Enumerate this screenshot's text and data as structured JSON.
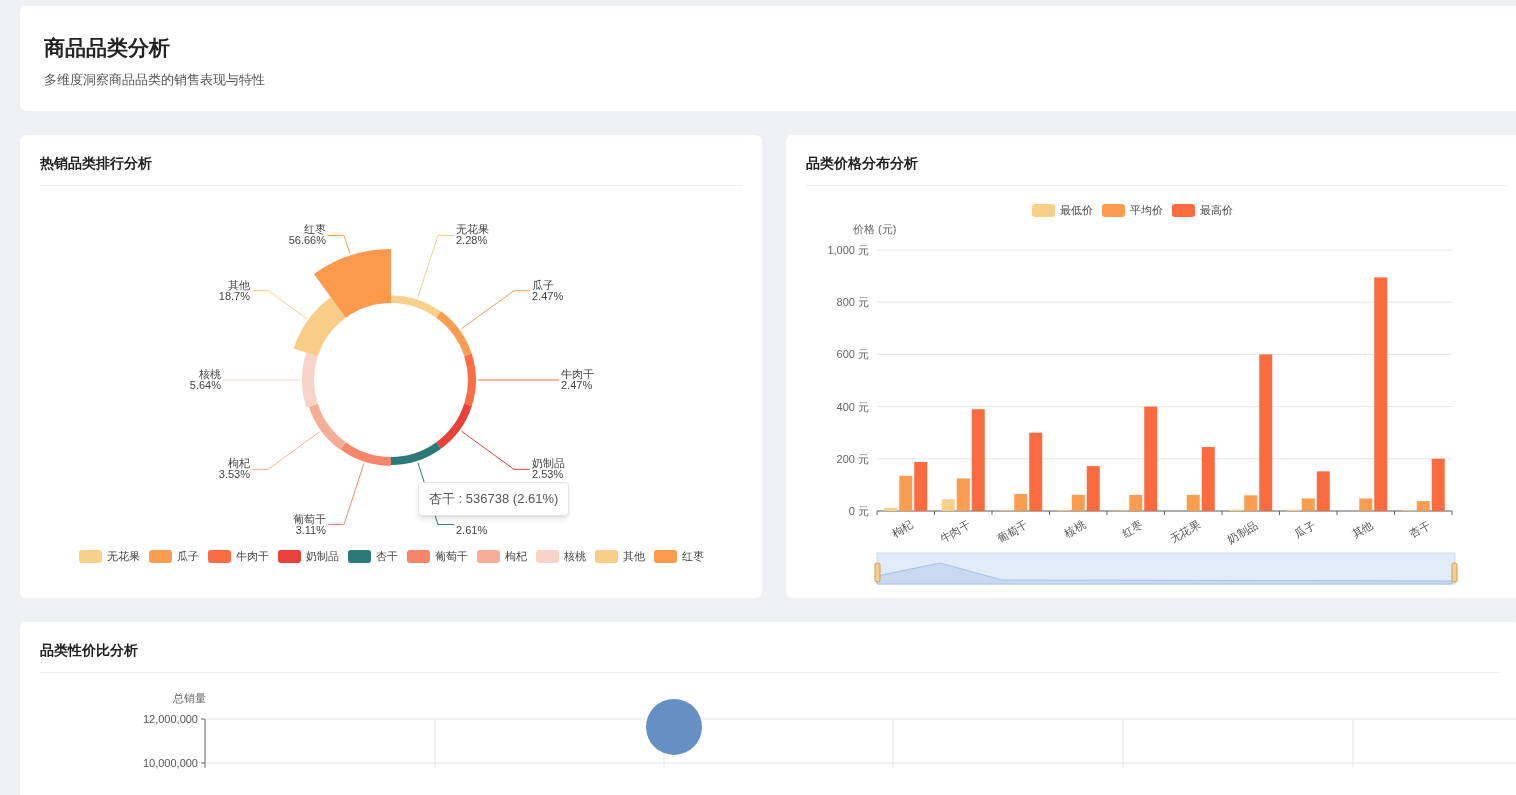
{
  "header": {
    "title": "商品品类分析",
    "subtitle": "多维度洞察商品品类的销售表现与特性"
  },
  "category_ranking": {
    "title": "热销品类排行分析",
    "slices": [
      {
        "kind": "labeled",
        "name": "无花果",
        "percent": "2.28%",
        "color": "#f9d08a"
      },
      {
        "kind": "labeled",
        "name": "瓜子",
        "percent": "2.47%",
        "color": "#fb9d50"
      },
      {
        "kind": "labeled",
        "name": "牛肉干",
        "percent": "2.47%",
        "color": "#fa6c41"
      },
      {
        "kind": "labeled",
        "name": "奶制品",
        "percent": "2.53%",
        "color": "#e8403a"
      },
      {
        "kind": "covered",
        "percent": "2.61%",
        "color": "#2c7a78"
      },
      {
        "kind": "labeled",
        "name": "葡萄干",
        "percent": "3.11%",
        "color": "#f4876a"
      },
      {
        "kind": "labeled",
        "name": "枸杞",
        "percent": "3.53%",
        "color": "#f5ad98"
      },
      {
        "kind": "labeled",
        "name": "核桃",
        "percent": "5.64%",
        "color": "#fad3c8"
      },
      {
        "kind": "labeled",
        "name": "其他",
        "percent": "18.7%",
        "color": "#f8cd85"
      },
      {
        "kind": "labeled",
        "name": "红枣",
        "percent": "56.66%",
        "color": "#fb9a4d"
      }
    ],
    "tooltip": "杏干 : 536738 (2.61%)",
    "legend": [
      {
        "label": "无花果",
        "color": "#f9d08a"
      },
      {
        "label": "瓜子",
        "color": "#fb9d50"
      },
      {
        "label": "牛肉干",
        "color": "#fa6c41"
      },
      {
        "label": "奶制品",
        "color": "#e8403a"
      },
      {
        "label": "杏干",
        "color": "#2c7a78"
      },
      {
        "label": "葡萄干",
        "color": "#f4876a"
      },
      {
        "label": "枸杞",
        "color": "#f5ad98"
      },
      {
        "label": "核桃",
        "color": "#fad3c8"
      },
      {
        "label": "其他",
        "color": "#f8cd85"
      },
      {
        "label": "红枣",
        "color": "#fb9a4d"
      }
    ]
  },
  "price_distribution": {
    "title": "品类价格分布分析",
    "chart_data": {
      "type": "bar",
      "legend": "top",
      "grid": true,
      "ylabel": "价格 (元)",
      "categories": [
        "枸杞",
        "牛肉干",
        "葡萄干",
        "核桃",
        "红枣",
        "无花果",
        "奶制品",
        "瓜子",
        "其他",
        "杏干"
      ],
      "ylim": [
        0,
        1000
      ],
      "yticks": [
        {
          "value": 0,
          "label": "0 元"
        },
        {
          "value": 200,
          "label": "200 元"
        },
        {
          "value": 400,
          "label": "400 元"
        },
        {
          "value": 600,
          "label": "600 元"
        },
        {
          "value": 800,
          "label": "800 元"
        },
        {
          "value": 1000,
          "label": "1,000 元"
        }
      ],
      "series": [
        {
          "name": "最低价",
          "color": "#f9ce88",
          "values": [
            12,
            45,
            2,
            3,
            2,
            null,
            5,
            5,
            null,
            3
          ]
        },
        {
          "name": "平均价",
          "color": "#fb9d50",
          "values": [
            135,
            125,
            65,
            62,
            62,
            62,
            60,
            48,
            48,
            38
          ]
        },
        {
          "name": "最高价",
          "color": "#fb6b40",
          "values": [
            188,
            390,
            300,
            172,
            400,
            245,
            600,
            152,
            895,
            200
          ]
        }
      ]
    }
  },
  "value_analysis": {
    "title": "品类性价比分析",
    "chart_data": {
      "type": "scatter",
      "grid": true,
      "ylabel": "总销量",
      "ylim": [
        9780000,
        12000000
      ],
      "yticks": [
        {
          "value": 10000000,
          "label": "10,000,000"
        },
        {
          "value": 12000000,
          "label": "12,000,000"
        }
      ],
      "series": [
        {
          "color": "#6690c4",
          "values": [
            11640000
          ]
        }
      ]
    }
  }
}
